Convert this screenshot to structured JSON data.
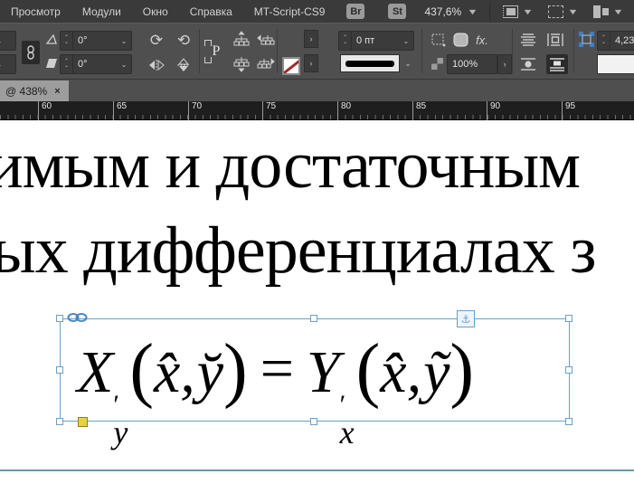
{
  "menubar": {
    "items": [
      "Просмотр",
      "Модули",
      "Окно",
      "Справка",
      "MT-Script-CS9"
    ],
    "bridge_label": "Br",
    "stock_label": "St",
    "zoom_value": "437,6%"
  },
  "control_panel": {
    "rotation_angle": "0°",
    "shear_angle": "0°",
    "p_label": "P",
    "stroke_weight": "0 пт",
    "opacity": "100%",
    "fx_label": "fx.",
    "offset_value": "4,23"
  },
  "tabbar": {
    "active_tab": "@ 438%",
    "close": "×"
  },
  "ruler": {
    "ticks": [
      "60",
      "65",
      "70",
      "75",
      "80",
      "85",
      "90",
      "95"
    ]
  },
  "document": {
    "line1": "имым и достаточным",
    "line2": "ых дифференциалах з",
    "formula": {
      "lhs_base": "X",
      "lhs_prime": "′",
      "lhs_sub": "y",
      "open1": "(",
      "arg1_x": "x̂",
      "comma1": ",",
      "arg1_y": "y̆",
      "close1": ")",
      "equals": "=",
      "rhs_base": "Y",
      "rhs_prime": "′",
      "rhs_sub": "x",
      "open2": "(",
      "arg2_x": "x̂",
      "comma2": ",",
      "arg2_y": "ỹ",
      "close2": ")"
    },
    "anchor_glyph": "⚓"
  },
  "colors": {
    "selection_blue": "#69a0c8",
    "guide_blue": "#6f94aa",
    "handle_yellow": "#e8d23e",
    "swatch_none_red": "#a32a2a",
    "panel_bg": "#4f4f4f",
    "menubar_bg": "#3a3a3a",
    "ruler_bg": "#1e1e1e"
  }
}
